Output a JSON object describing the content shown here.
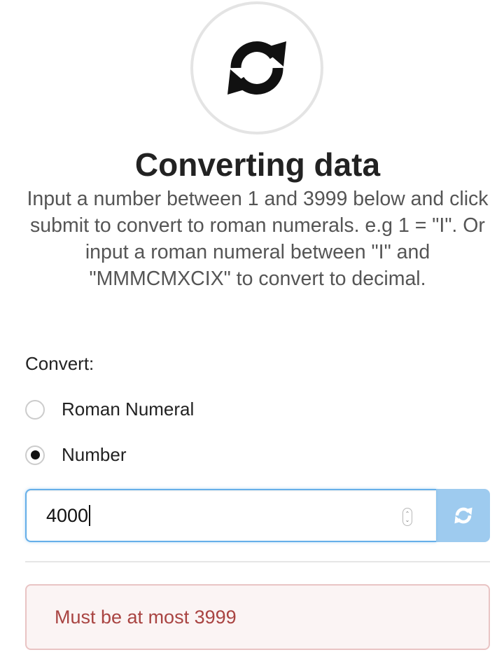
{
  "header": {
    "icon": "refresh-icon",
    "title": "Converting data",
    "description": "Input a number between 1 and 3999 below and click submit to convert to roman numerals. e.g 1 = \"I\". Or input a roman numeral between \"I\" and \"MMMCMXCIX\" to convert to decimal."
  },
  "form": {
    "convert_label": "Convert:",
    "options": [
      {
        "label": "Roman Numeral",
        "selected": false
      },
      {
        "label": "Number",
        "selected": true
      }
    ],
    "input_value": "4000",
    "submit_icon": "refresh-icon"
  },
  "error": {
    "message": "Must be at most 3999"
  },
  "colors": {
    "accent": "#9ecbef",
    "input_focus_border": "#66afe9",
    "error_text": "#a94442",
    "error_background": "#fbf4f4",
    "error_border": "#e9c4c4"
  }
}
